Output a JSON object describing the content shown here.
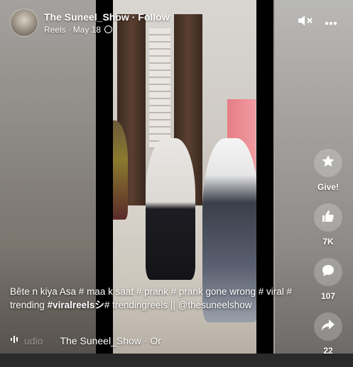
{
  "header": {
    "channel_name": "The Suneel_Show",
    "separator": "·",
    "follow_label": "Follow",
    "source": "Reels",
    "date": "May 18",
    "audience_icon": "globe-icon"
  },
  "top_controls": {
    "mute_icon": "speaker-muted-icon",
    "more_icon": "more-horizontal-icon"
  },
  "actions": [
    {
      "name": "give",
      "icon": "star-gift-icon",
      "label": "Give!"
    },
    {
      "name": "like",
      "icon": "thumbs-up-icon",
      "label": "7K"
    },
    {
      "name": "comment",
      "icon": "comment-icon",
      "label": "107"
    },
    {
      "name": "share",
      "icon": "share-arrow-icon",
      "label": "22"
    }
  ],
  "caption": {
    "part1": "Bête n kiya Asa # maa k saat # prank # prank gone wrong # viral # trending ",
    "hashtag_bold": "#viralreelsシ",
    "part2": "# trendingreels || @thesuneelshow"
  },
  "audio": {
    "icon": "audio-wave-icon",
    "label_faded": "udio",
    "track": "The Suneel_Show · Or"
  }
}
